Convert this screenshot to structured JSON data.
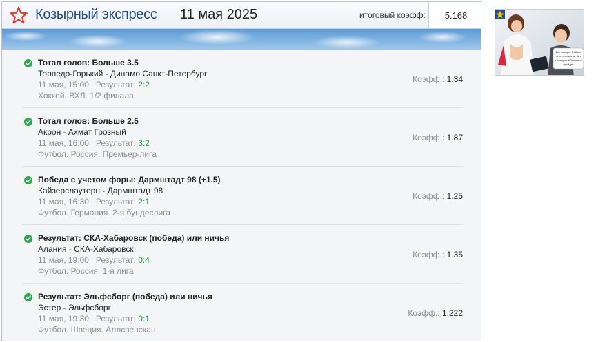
{
  "header": {
    "brand": "Козырный экспресс",
    "date": "11 мая 2025",
    "total_label": "итоговый коэфф:",
    "total_value": "5.168"
  },
  "coef_label": "Коэфф.:",
  "result_label": "Результат:",
  "bets": [
    {
      "title": "Тотал голов: Больше 3.5",
      "match": "Торпедо-Горький - Динамо Санкт-Петербург",
      "time": "11 мая, 15:00",
      "result": "2:2",
      "league": "Хоккей. ВХЛ. 1/2 финала",
      "coef": "1.34"
    },
    {
      "title": "Тотал голов: Больше 2.5",
      "match": "Акрон - Ахмат Грозный",
      "time": "11 мая, 16:00",
      "result": "3:2",
      "league": "Футбол. Россия. Премьер-лига",
      "coef": "1.87"
    },
    {
      "title": "Победа с учетом форы: Дармштадт 98 (+1.5)",
      "match": "Кайзерслаутерн - Дармштадт 98",
      "time": "11 мая, 16:30",
      "result": "2:1",
      "league": "Футбол. Германия. 2-я бундеслига",
      "coef": "1.25"
    },
    {
      "title": "Результат: СКА-Хабаровск (победа) или ничья",
      "match": "Алания - СКА-Хабаровск",
      "time": "11 мая, 19:00",
      "result": "0:4",
      "league": "Футбол. Россия. 1-я лига",
      "coef": "1.35"
    },
    {
      "title": "Результат: Эльфсборг (победа) или ничья",
      "match": "Эстер - Эльфсборг",
      "time": "11 мая, 19:30",
      "result": "0:1",
      "league": "Футбол. Швеция. Аллсвенскан",
      "coef": "1.222"
    }
  ],
  "ad": {
    "icon": "star-icon",
    "caption_lines": [
      "Вот смотри. Сейчас",
      "этот чемпионат бит",
      "и Козырный Экспресс",
      "пройдет"
    ]
  },
  "colors": {
    "brand": "#1f4d8e",
    "star": "#e2362b",
    "check": "#2ba84a",
    "result": "#1f9a3a"
  }
}
